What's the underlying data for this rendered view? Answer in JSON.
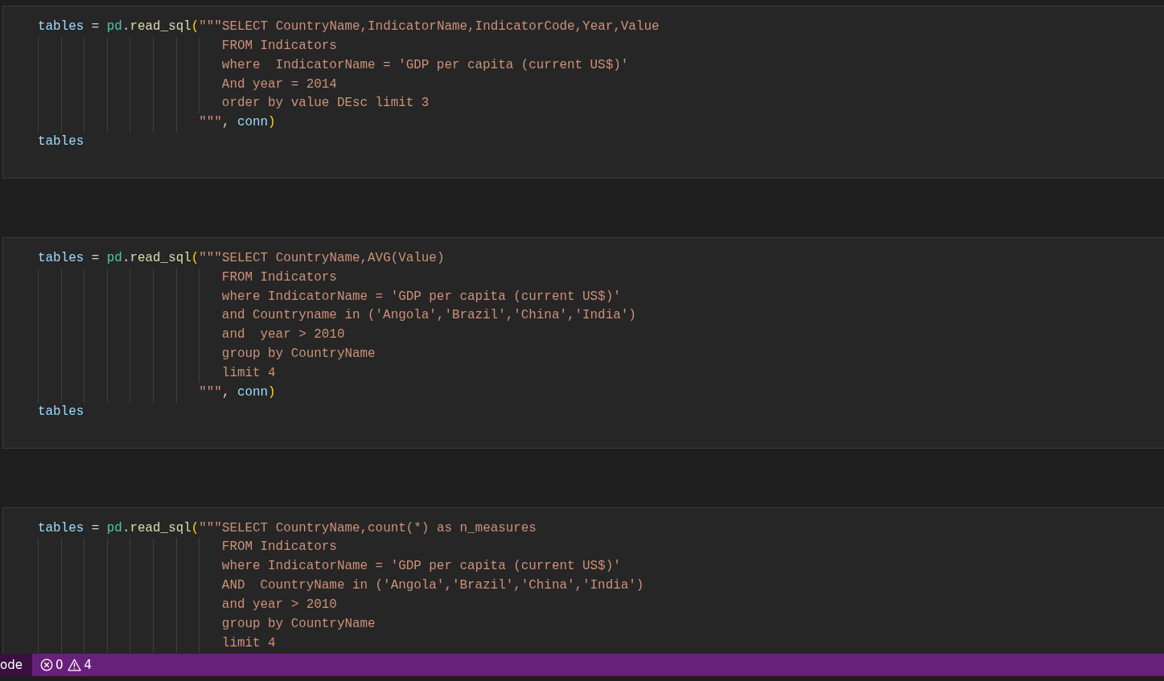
{
  "cells": [
    {
      "lines": [
        [
          {
            "kind": "variable",
            "text": "tables"
          },
          {
            "kind": "operator",
            "text": " = "
          },
          {
            "kind": "module",
            "text": "pd"
          },
          {
            "kind": "operator",
            "text": "."
          },
          {
            "kind": "function",
            "text": "read_sql"
          },
          {
            "kind": "bracket",
            "text": "("
          },
          {
            "kind": "string",
            "text": "\"\"\"SELECT CountryName,IndicatorName,IndicatorCode,Year,Value"
          }
        ],
        [
          {
            "kind": "string",
            "text": "                        FROM Indicators"
          }
        ],
        [
          {
            "kind": "string",
            "text": "                        where  IndicatorName = 'GDP per capita (current US$)'"
          }
        ],
        [
          {
            "kind": "string",
            "text": "                        And year = 2014"
          }
        ],
        [
          {
            "kind": "string",
            "text": "                        order by value DEsc limit 3"
          }
        ],
        [
          {
            "kind": "string",
            "text": "                     \"\"\""
          },
          {
            "kind": "operator",
            "text": ", "
          },
          {
            "kind": "variable",
            "text": "conn"
          },
          {
            "kind": "bracket",
            "text": ")"
          }
        ],
        [
          {
            "kind": "variable",
            "text": "tables"
          }
        ]
      ]
    },
    {
      "lines": [
        [
          {
            "kind": "variable",
            "text": "tables"
          },
          {
            "kind": "operator",
            "text": " = "
          },
          {
            "kind": "module",
            "text": "pd"
          },
          {
            "kind": "operator",
            "text": "."
          },
          {
            "kind": "function",
            "text": "read_sql"
          },
          {
            "kind": "bracket",
            "text": "("
          },
          {
            "kind": "string",
            "text": "\"\"\"SELECT CountryName,AVG(Value)"
          }
        ],
        [
          {
            "kind": "string",
            "text": "                        FROM Indicators"
          }
        ],
        [
          {
            "kind": "string",
            "text": "                        where IndicatorName = 'GDP per capita (current US$)'"
          }
        ],
        [
          {
            "kind": "string",
            "text": "                        and Countryname in ('Angola','Brazil','China','India')"
          }
        ],
        [
          {
            "kind": "string",
            "text": "                        and  year > 2010"
          }
        ],
        [
          {
            "kind": "string",
            "text": "                        group by CountryName"
          }
        ],
        [
          {
            "kind": "string",
            "text": "                        limit 4"
          }
        ],
        [
          {
            "kind": "string",
            "text": "                     \"\"\""
          },
          {
            "kind": "operator",
            "text": ", "
          },
          {
            "kind": "variable",
            "text": "conn"
          },
          {
            "kind": "bracket",
            "text": ")"
          }
        ],
        [
          {
            "kind": "variable",
            "text": "tables"
          }
        ]
      ]
    },
    {
      "lines": [
        [
          {
            "kind": "variable",
            "text": "tables"
          },
          {
            "kind": "operator",
            "text": " = "
          },
          {
            "kind": "module",
            "text": "pd"
          },
          {
            "kind": "operator",
            "text": "."
          },
          {
            "kind": "function",
            "text": "read_sql"
          },
          {
            "kind": "bracket",
            "text": "("
          },
          {
            "kind": "string",
            "text": "\"\"\"SELECT CountryName,count(*) as n_measures"
          }
        ],
        [
          {
            "kind": "string",
            "text": "                        FROM Indicators"
          }
        ],
        [
          {
            "kind": "string",
            "text": "                        where IndicatorName = 'GDP per capita (current US$)'"
          }
        ],
        [
          {
            "kind": "string",
            "text": "                        AND  CountryName in ('Angola','Brazil','China','India')"
          }
        ],
        [
          {
            "kind": "string",
            "text": "                        and year > 2010"
          }
        ],
        [
          {
            "kind": "string",
            "text": "                        group by CountryName"
          }
        ],
        [
          {
            "kind": "string",
            "text": "                        limit 4"
          }
        ]
      ]
    }
  ],
  "status_bar": {
    "mode": "ode",
    "errors": "0",
    "warnings": "4"
  }
}
